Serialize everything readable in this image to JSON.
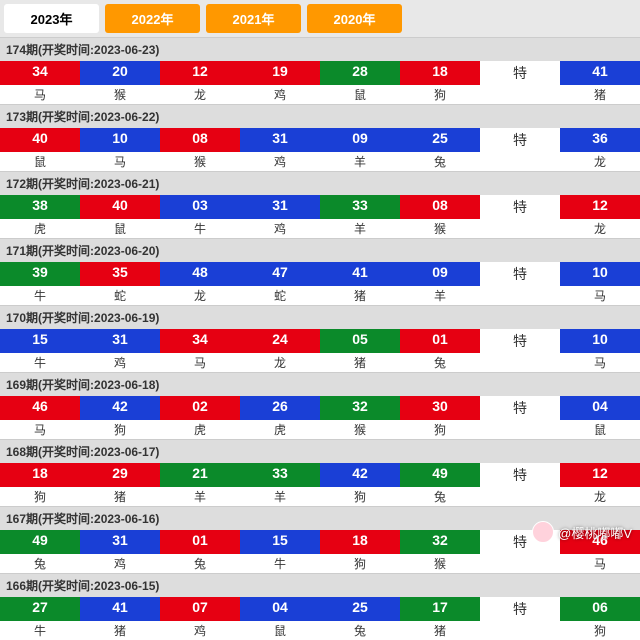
{
  "tabs": [
    {
      "label": "2023年",
      "active": true
    },
    {
      "label": "2022年",
      "active": false
    },
    {
      "label": "2021年",
      "active": false
    },
    {
      "label": "2020年",
      "active": false
    }
  ],
  "special_label": "特",
  "watermark": {
    "handle": "@樱桃嘟嘟V"
  },
  "periods": [
    {
      "head": "174期(开奖时间:2023-06-23)",
      "balls": [
        {
          "n": "34",
          "c": "red",
          "z": "马"
        },
        {
          "n": "20",
          "c": "blue",
          "z": "猴"
        },
        {
          "n": "12",
          "c": "red",
          "z": "龙"
        },
        {
          "n": "19",
          "c": "red",
          "z": "鸡"
        },
        {
          "n": "28",
          "c": "green",
          "z": "鼠"
        },
        {
          "n": "18",
          "c": "red",
          "z": "狗"
        },
        {
          "sp": true
        },
        {
          "n": "41",
          "c": "blue",
          "z": "猪"
        }
      ]
    },
    {
      "head": "173期(开奖时间:2023-06-22)",
      "balls": [
        {
          "n": "40",
          "c": "red",
          "z": "鼠"
        },
        {
          "n": "10",
          "c": "blue",
          "z": "马"
        },
        {
          "n": "08",
          "c": "red",
          "z": "猴"
        },
        {
          "n": "31",
          "c": "blue",
          "z": "鸡"
        },
        {
          "n": "09",
          "c": "blue",
          "z": "羊"
        },
        {
          "n": "25",
          "c": "blue",
          "z": "兔"
        },
        {
          "sp": true
        },
        {
          "n": "36",
          "c": "blue",
          "z": "龙"
        }
      ]
    },
    {
      "head": "172期(开奖时间:2023-06-21)",
      "balls": [
        {
          "n": "38",
          "c": "green",
          "z": "虎"
        },
        {
          "n": "40",
          "c": "red",
          "z": "鼠"
        },
        {
          "n": "03",
          "c": "blue",
          "z": "牛"
        },
        {
          "n": "31",
          "c": "blue",
          "z": "鸡"
        },
        {
          "n": "33",
          "c": "green",
          "z": "羊"
        },
        {
          "n": "08",
          "c": "red",
          "z": "猴"
        },
        {
          "sp": true
        },
        {
          "n": "12",
          "c": "red",
          "z": "龙"
        }
      ]
    },
    {
      "head": "171期(开奖时间:2023-06-20)",
      "balls": [
        {
          "n": "39",
          "c": "green",
          "z": "牛"
        },
        {
          "n": "35",
          "c": "red",
          "z": "蛇"
        },
        {
          "n": "48",
          "c": "blue",
          "z": "龙"
        },
        {
          "n": "47",
          "c": "blue",
          "z": "蛇"
        },
        {
          "n": "41",
          "c": "blue",
          "z": "猪"
        },
        {
          "n": "09",
          "c": "blue",
          "z": "羊"
        },
        {
          "sp": true
        },
        {
          "n": "10",
          "c": "blue",
          "z": "马"
        }
      ]
    },
    {
      "head": "170期(开奖时间:2023-06-19)",
      "balls": [
        {
          "n": "15",
          "c": "blue",
          "z": "牛"
        },
        {
          "n": "31",
          "c": "blue",
          "z": "鸡"
        },
        {
          "n": "34",
          "c": "red",
          "z": "马"
        },
        {
          "n": "24",
          "c": "red",
          "z": "龙"
        },
        {
          "n": "05",
          "c": "green",
          "z": "猪"
        },
        {
          "n": "01",
          "c": "red",
          "z": "兔"
        },
        {
          "sp": true
        },
        {
          "n": "10",
          "c": "blue",
          "z": "马"
        }
      ]
    },
    {
      "head": "169期(开奖时间:2023-06-18)",
      "balls": [
        {
          "n": "46",
          "c": "red",
          "z": "马"
        },
        {
          "n": "42",
          "c": "blue",
          "z": "狗"
        },
        {
          "n": "02",
          "c": "red",
          "z": "虎"
        },
        {
          "n": "26",
          "c": "blue",
          "z": "虎"
        },
        {
          "n": "32",
          "c": "green",
          "z": "猴"
        },
        {
          "n": "30",
          "c": "red",
          "z": "狗"
        },
        {
          "sp": true
        },
        {
          "n": "04",
          "c": "blue",
          "z": "鼠"
        }
      ]
    },
    {
      "head": "168期(开奖时间:2023-06-17)",
      "balls": [
        {
          "n": "18",
          "c": "red",
          "z": "狗"
        },
        {
          "n": "29",
          "c": "red",
          "z": "猪"
        },
        {
          "n": "21",
          "c": "green",
          "z": "羊"
        },
        {
          "n": "33",
          "c": "green",
          "z": "羊"
        },
        {
          "n": "42",
          "c": "blue",
          "z": "狗"
        },
        {
          "n": "49",
          "c": "green",
          "z": "兔"
        },
        {
          "sp": true
        },
        {
          "n": "12",
          "c": "red",
          "z": "龙"
        }
      ]
    },
    {
      "head": "167期(开奖时间:2023-06-16)",
      "balls": [
        {
          "n": "49",
          "c": "green",
          "z": "兔"
        },
        {
          "n": "31",
          "c": "blue",
          "z": "鸡"
        },
        {
          "n": "01",
          "c": "red",
          "z": "兔"
        },
        {
          "n": "15",
          "c": "blue",
          "z": "牛"
        },
        {
          "n": "18",
          "c": "red",
          "z": "狗"
        },
        {
          "n": "32",
          "c": "green",
          "z": "猴"
        },
        {
          "sp": true
        },
        {
          "n": "46",
          "c": "red",
          "z": "马"
        }
      ]
    },
    {
      "head": "166期(开奖时间:2023-06-15)",
      "balls": [
        {
          "n": "27",
          "c": "green",
          "z": "牛"
        },
        {
          "n": "41",
          "c": "blue",
          "z": "猪"
        },
        {
          "n": "07",
          "c": "red",
          "z": "鸡"
        },
        {
          "n": "04",
          "c": "blue",
          "z": "鼠"
        },
        {
          "n": "25",
          "c": "blue",
          "z": "兔"
        },
        {
          "n": "17",
          "c": "green",
          "z": "猪"
        },
        {
          "sp": true
        },
        {
          "n": "06",
          "c": "green",
          "z": "狗"
        }
      ]
    }
  ]
}
